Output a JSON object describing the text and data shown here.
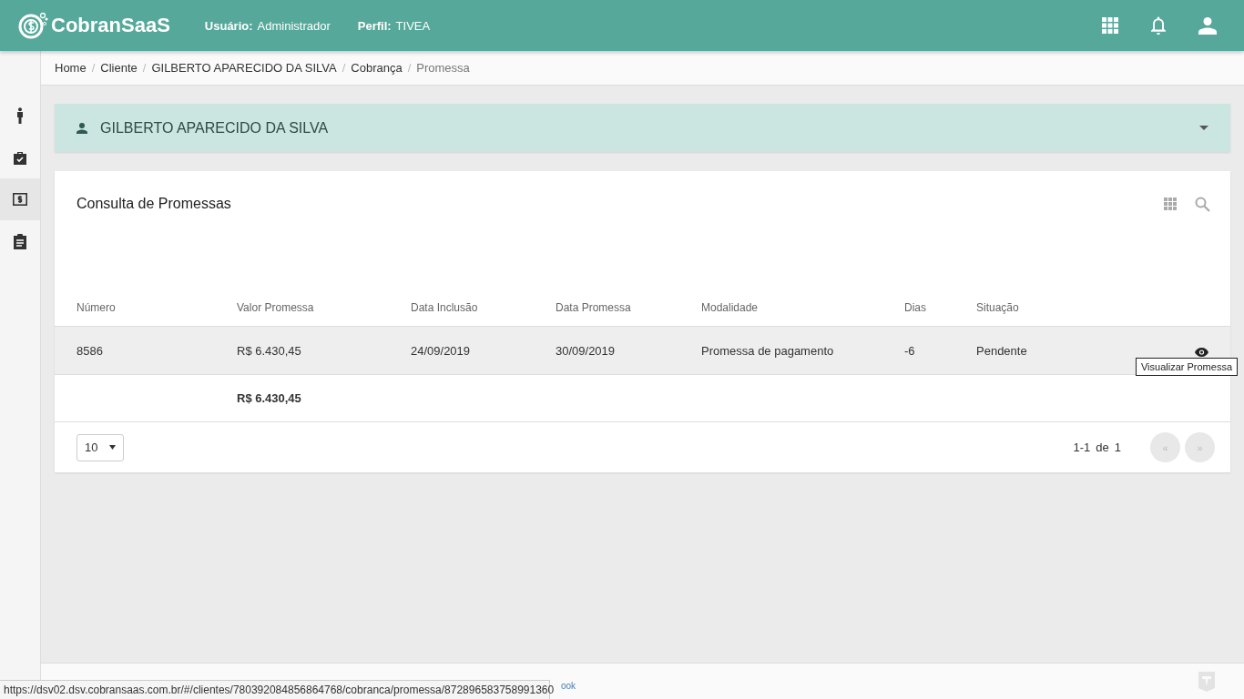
{
  "header": {
    "logo": "CobranSaaS",
    "user_label": "Usuário:",
    "user": "Administrador",
    "profile_label": "Perfil:",
    "profile": "TIVEA"
  },
  "breadcrumb_separator": "/",
  "breadcrumb": [
    {
      "label": "Home",
      "current": false
    },
    {
      "label": "Cliente",
      "current": false
    },
    {
      "label": "GILBERTO APARECIDO DA SILVA",
      "current": false
    },
    {
      "label": "Cobrança",
      "current": false
    },
    {
      "label": "Promessa",
      "current": true
    }
  ],
  "sidebar": {
    "items": [
      {
        "kind": "person",
        "selected": false
      },
      {
        "kind": "briefcase",
        "selected": false
      },
      {
        "kind": "money",
        "selected": true
      },
      {
        "kind": "clipboard",
        "selected": false
      }
    ]
  },
  "client": {
    "name": "GILBERTO APARECIDO DA SILVA"
  },
  "card": {
    "title": "Consulta de Promessas",
    "columns": [
      "Número",
      "Valor Promessa",
      "Data Inclusão",
      "Data Promessa",
      "Modalidade",
      "Dias",
      "Situação"
    ],
    "rows": [
      {
        "cells": [
          "8586",
          "R$ 6.430,45",
          "24/09/2019",
          "30/09/2019",
          "Promessa de pagamento",
          "-6",
          "Pendente"
        ],
        "selected": true
      }
    ],
    "total": "R$ 6.430,45",
    "page_size": "10",
    "range": "1-1",
    "of": "de",
    "count": "1",
    "prev": "«",
    "next": "»"
  },
  "tooltip": "Visualizar Promessa",
  "footer": {
    "link": "ook"
  },
  "status_url": "https://dsv02.dsv.cobransaas.com.br/#/clientes/780392084856864768/cobranca/promessa/872896583758991360"
}
